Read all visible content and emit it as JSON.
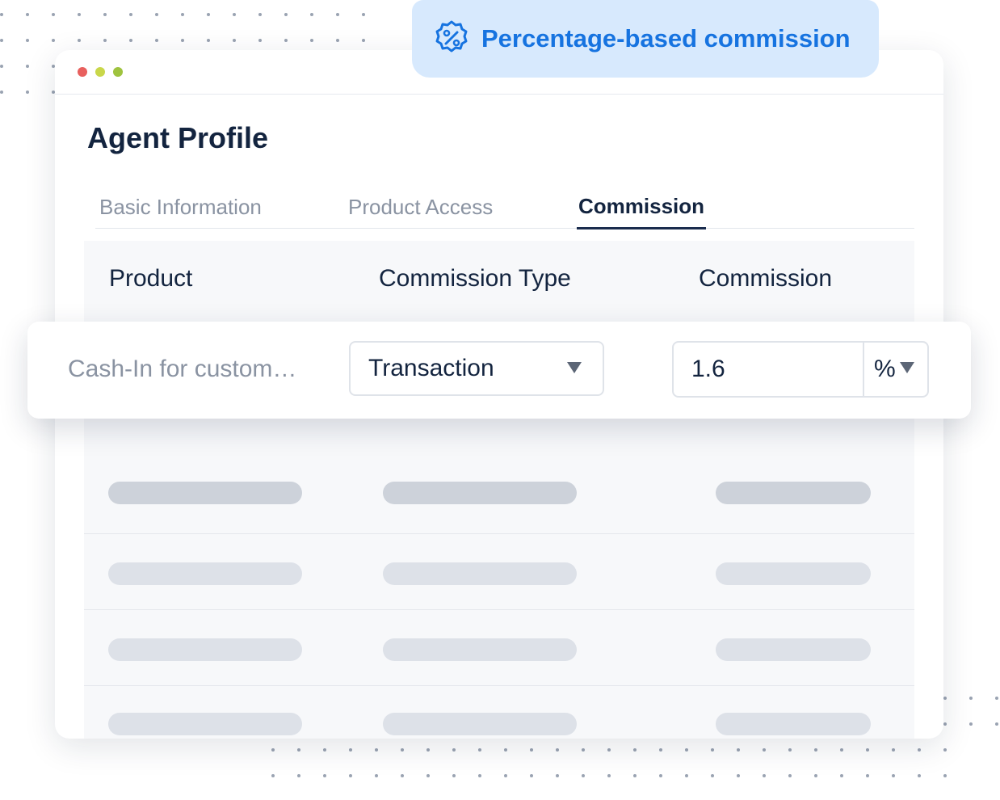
{
  "colors": {
    "window_dot_red": "#e8605e",
    "window_dot_yellow": "#c9d74a",
    "window_dot_green": "#9fc33f",
    "badge_bg": "#d7e9fd",
    "badge_text": "#1673e0",
    "heading": "#13243f",
    "muted": "#8a93a2"
  },
  "badge": {
    "icon": "percent-badge-icon",
    "text": "Percentage-based commission"
  },
  "page": {
    "title": "Agent Profile"
  },
  "tabs": [
    {
      "label": "Basic Information",
      "active": false
    },
    {
      "label": "Product Access",
      "active": false
    },
    {
      "label": "Commission",
      "active": true
    }
  ],
  "table": {
    "columns": [
      "Product",
      "Commission Type",
      "Commission"
    ],
    "active_row": {
      "product": "Cash-In for custom…",
      "commission_type": "Transaction",
      "commission_value": "1.6",
      "commission_unit": "%"
    }
  }
}
